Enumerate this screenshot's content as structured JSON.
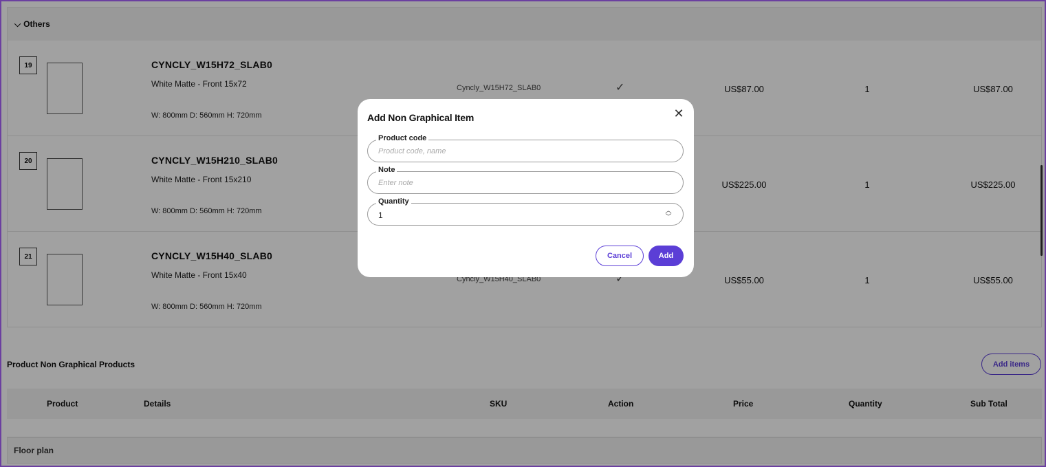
{
  "section": {
    "chevron": "chevron-down-icon",
    "title": "Others"
  },
  "rows": [
    {
      "index": "19",
      "title": "CYNCLY_W15H72_SLAB0",
      "description": "White Matte - Front 15x72",
      "dims": "W: 800mm  D: 560mm  H: 720mm",
      "sku": "Cyncly_W15H72_SLAB0",
      "price": "US$87.00",
      "quantity": "1",
      "subtotal": "US$87.00"
    },
    {
      "index": "20",
      "title": "CYNCLY_W15H210_SLAB0",
      "description": "White Matte - Front 15x210",
      "dims": "W: 800mm  D: 560mm  H: 720mm",
      "sku": "",
      "price": "US$225.00",
      "quantity": "1",
      "subtotal": "US$225.00"
    },
    {
      "index": "21",
      "title": "CYNCLY_W15H40_SLAB0",
      "description": "White Matte - Front 15x40",
      "dims": "W: 800mm  D: 560mm  H: 720mm",
      "sku": "Cyncly_W15H40_SLAB0",
      "price": "US$55.00",
      "quantity": "1",
      "subtotal": "US$55.00"
    }
  ],
  "non_graphical": {
    "title": "Product Non Graphical Products",
    "add_items_label": "Add items",
    "columns": [
      "Product",
      "Details",
      "SKU",
      "Action",
      "Price",
      "Quantity",
      "Sub Total"
    ]
  },
  "floor_plan": {
    "label": "Floor plan"
  },
  "modal": {
    "title": "Add Non Graphical Item",
    "close_icon": "close-icon",
    "product_code": {
      "label": "Product code",
      "placeholder": "Product code, name"
    },
    "note": {
      "label": "Note",
      "placeholder": "Enter note"
    },
    "quantity": {
      "label": "Quantity",
      "value": "1"
    },
    "cancel_label": "Cancel",
    "add_label": "Add"
  },
  "colors": {
    "accent": "#5b3ed6",
    "frame": "#6b3fa0",
    "overlay": "rgba(0,0,0,0.37)"
  }
}
